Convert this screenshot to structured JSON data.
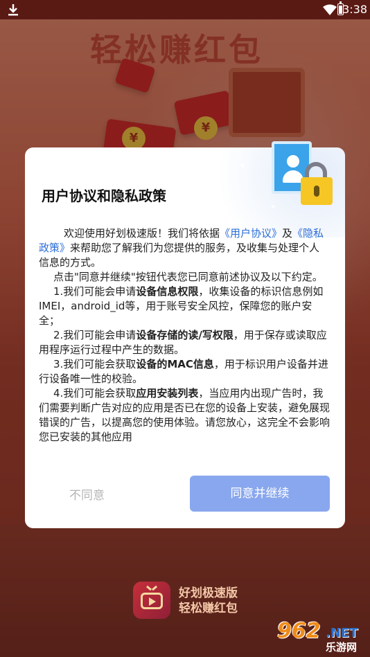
{
  "status_bar": {
    "time": "3:38",
    "icons": [
      "download-icon",
      "wifi-icon",
      "battery-icon"
    ]
  },
  "background": {
    "banner_text": "轻松赚红包",
    "coin_symbol": "¥"
  },
  "dialog": {
    "title": "用户协议和隐私政策",
    "body": {
      "p1_pre": "欢迎使用好划极速版！我们将依据",
      "p1_link1": "《用户协议》",
      "p1_mid": "及",
      "p1_link2": "《隐私政策》",
      "p1_post": "来帮助您了解我们为您提供的服务，及收集与处理个人信息的方式。",
      "p2": "点击\"同意并继续\"按钮代表您已同意前述协议及以下约定。",
      "item1_pre": "1.我们可能会申请",
      "item1_bold": "设备信息权限",
      "item1_post": "，收集设备的标识信息例如IMEI，android_id等，用于账号安全风控，保障您的账户安全；",
      "item2_pre": "2.我们可能会申请",
      "item2_bold": "设备存储的读/写权限",
      "item2_post": "，用于保存或读取应用程序运行过程中产生的数据。",
      "item3_pre": "3.我们可能会获取",
      "item3_bold": "设备的MAC信息",
      "item3_post": "，用于标识用户设备并进行设备唯一性的校验。",
      "item4_pre": "4.我们可能会获取",
      "item4_bold": "应用安装列表",
      "item4_post": "，当应用内出现广告时，我们需要判断广告对应的应用是否已在您的设备上安装，避免展现错误的广告，以提高您的使用体验。请您放心，这完全不会影响您已安装的其他应用"
    },
    "disagree_label": "不同意",
    "agree_label": "同意并继续"
  },
  "brand": {
    "name": "好划极速版",
    "slogan": "轻松赚红包"
  },
  "watermark": {
    "number": "962",
    "suffix": ".NET",
    "site": "乐游网"
  },
  "colors": {
    "agree_button": "#89a7ee",
    "link": "#2c6ed6",
    "disagree_text": "#b5b5b5",
    "background_red": "#d9684e"
  }
}
